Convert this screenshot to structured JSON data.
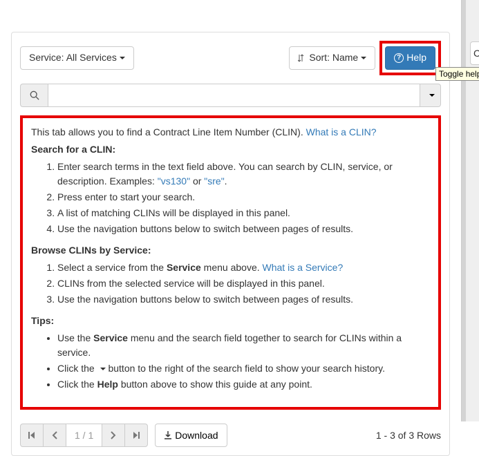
{
  "toolbar": {
    "service_label": "Service: All Services ",
    "sort_label": "Sort: Name ",
    "help_label": "Help"
  },
  "search": {
    "value": ""
  },
  "help": {
    "intro": "This tab allows you to find a Contract Line Item Number (CLIN). ",
    "what_is_clin": "What is a CLIN?",
    "search_heading": "Search for a CLIN:",
    "search_steps": {
      "0": {
        "a": "Enter search terms in the text field above. You can search by CLIN, service, or description. Examples: ",
        "link1": "\"vs130\"",
        "b": " or ",
        "link2": "\"sre\"",
        "c": "."
      },
      "1": "Press enter to start your search.",
      "2": "A list of matching CLINs will be displayed in this panel.",
      "3": "Use the navigation buttons below to switch between pages of results."
    },
    "browse_heading": "Browse CLINs by Service:",
    "browse_steps": {
      "0": {
        "a": "Select a service from the ",
        "bold": "Service",
        "b": " menu above. ",
        "link": "What is a Service?"
      },
      "1": "CLINs from the selected service will be displayed in this panel.",
      "2": "Use the navigation buttons below to switch between pages of results."
    },
    "tips_heading": "Tips:",
    "tips": {
      "0": {
        "a": "Use the ",
        "bold": "Service",
        "b": " menu and the search field together to search for CLINs within a service."
      },
      "1": {
        "a": "Click the ",
        "b": " button to the right of the search field to show your search history."
      },
      "2": {
        "a": "Click the ",
        "bold": "Help",
        "b": " button above to show this guide at any point."
      }
    }
  },
  "footer": {
    "page": "1 / 1",
    "download": "Download",
    "rows": "1 - 3 of 3 Rows"
  },
  "tooltip": {
    "text": "Toggle help te"
  },
  "side": {
    "cle": " Cle"
  }
}
